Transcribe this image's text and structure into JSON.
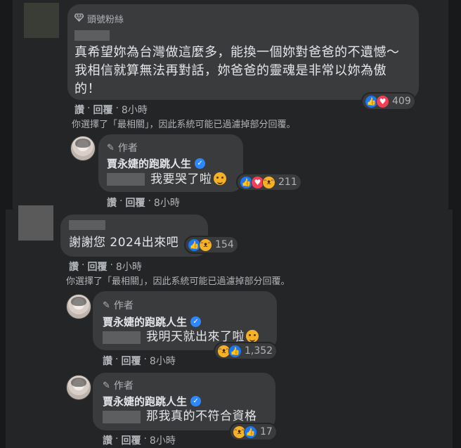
{
  "comment1": {
    "badge_icon": "diamond-icon",
    "badge_text": "頭號粉絲",
    "text_lines": [
      "真希望妳為台灣做這麼多，能換一個妳對爸爸的不遺憾～",
      "我相信就算無法再對話，妳爸爸的靈魂是非常以妳為傲",
      "的！"
    ],
    "reactions": {
      "icons": [
        "like",
        "love"
      ],
      "count": "409"
    },
    "actions": [
      "讚",
      "·",
      "回覆",
      "·",
      "8小時"
    ],
    "notice": "你選擇了「最相關」，因此系統可能已過濾掉部分回覆。",
    "reply": {
      "author_label": "作者",
      "author_name": "賈永婕的跑跳人生",
      "text": "我要哭了啦",
      "reactions": {
        "icons": [
          "like",
          "love",
          "haha"
        ],
        "count": "211"
      },
      "actions": [
        "讚",
        "·",
        "回覆",
        "·",
        "8小時"
      ]
    }
  },
  "comment2": {
    "text": "謝謝您 2024出來吧",
    "reactions": {
      "icons": [
        "like",
        "haha"
      ],
      "count": "154"
    },
    "actions": [
      "讚",
      "·",
      "回覆",
      "·",
      "8小時"
    ],
    "notice": "你選擇了「最相關」，因此系統可能已過濾掉部分回覆。",
    "replies": [
      {
        "author_label": "作者",
        "author_name": "賈永婕的跑跳人生",
        "text": "我明天就出來了啦",
        "reactions": {
          "icons": [
            "haha",
            "like"
          ],
          "count": "1,352"
        },
        "actions": [
          "讚",
          "·",
          "回覆",
          "·",
          "8小時"
        ]
      },
      {
        "author_label": "作者",
        "author_name": "賈永婕的跑跳人生",
        "text": "那我真的不符合資格",
        "reactions": {
          "icons": [
            "haha",
            "like"
          ],
          "count": "17"
        },
        "actions": [
          "讚",
          "·",
          "回覆",
          "·",
          "8小時"
        ]
      }
    ]
  },
  "colors": {
    "background": "#18191a",
    "panel": "#242526",
    "bubble": "#3a3b3c",
    "like": "#1877f2",
    "love": "#f33e58",
    "haha": "#f7b125",
    "verified": "#2d88ff"
  }
}
